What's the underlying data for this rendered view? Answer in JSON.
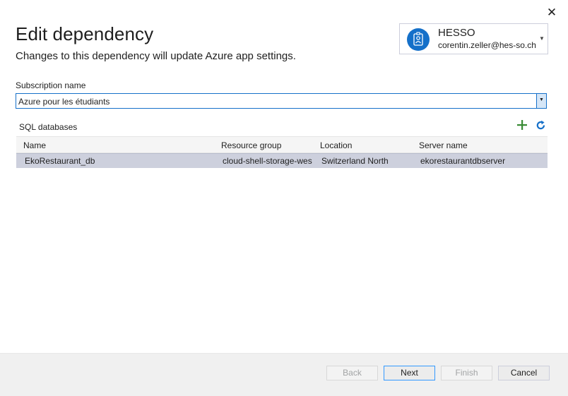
{
  "window": {
    "close_glyph": "✕"
  },
  "header": {
    "title": "Edit dependency",
    "subtitle": "Changes to this dependency will update Azure app settings."
  },
  "account": {
    "name": "HESSO",
    "email": "corentin.zeller@hes-so.ch",
    "icon": "user-badge-icon",
    "avatar_color": "#1570c9"
  },
  "subscription": {
    "label": "Subscription name",
    "value": "Azure pour les étudiants"
  },
  "databases": {
    "label": "SQL databases",
    "columns": [
      "Name",
      "Resource group",
      "Location",
      "Server name"
    ],
    "rows": [
      [
        "EkoRestaurant_db",
        "cloud-shell-storage-wes",
        "Switzerland North",
        "ekorestaurantdbserver"
      ]
    ],
    "selected_row_color": "#cdd0dd"
  },
  "footer": {
    "back": "Back",
    "next": "Next",
    "finish": "Finish",
    "cancel": "Cancel"
  },
  "colors": {
    "accent": "#1570c9",
    "add_icon": "#388a34",
    "refresh_icon": "#1570c9"
  }
}
